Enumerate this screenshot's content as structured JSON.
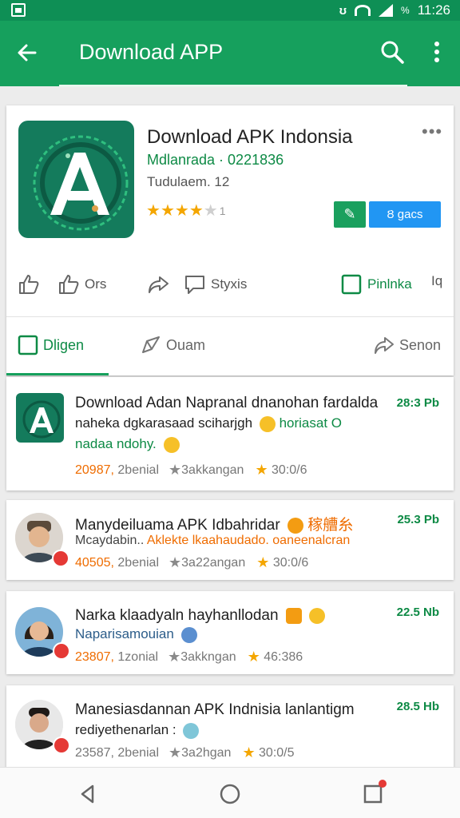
{
  "status_bar": {
    "time": "11:26",
    "battery_text": "%"
  },
  "app_bar": {
    "title": "Download APP"
  },
  "app": {
    "name": "Download APK Indonsia",
    "developer": "Mdlanrada · 0221836",
    "version": "Tudulaem. 12",
    "rating_stars": 4,
    "rating_count": "1",
    "install_label": "Ȣ gacs"
  },
  "actions": {
    "like_label": "",
    "thumbs_label": "Ors",
    "share_label": "",
    "comment_label": "Styxis",
    "save_label": "Pinlnka",
    "info_label": "Iq"
  },
  "tabs": [
    {
      "label": "Dligen",
      "active": true
    },
    {
      "label": "Ouam",
      "active": false
    },
    {
      "label": "Senon",
      "active": false
    }
  ],
  "feed": [
    {
      "title": "Download Adan Napranal dnanohan fardalda",
      "line2": "naheka dgkarasaad sciharjgh",
      "line2b": "horiasat O",
      "line3": "nadaa ndohy.",
      "time": "28:3 Pb",
      "count": "20987,",
      "count_label": "2benial",
      "metric": "3akkangan",
      "rating": "30:0/6"
    },
    {
      "title": "Manydeiluama APK Idbahridar",
      "title_suffix": "稼艚糸",
      "subtitle": "Mcaydabin..",
      "subtitle_orange": "Aklekte lkaahaudado. oaneenalcran",
      "time": "25.3 Pb",
      "count": "40505,",
      "count_label": "2benial",
      "metric": "3a22angan",
      "rating": "30:0/6"
    },
    {
      "title": "Narka klaadyaln hayhanllodan",
      "subtitle": "Naparisamouian",
      "time": "22.5 Nb",
      "count": "23807,",
      "count_label": "1zonial",
      "metric": "3akkngan",
      "rating": "46:386"
    },
    {
      "title": "Manesiasdannan APK Indnisia lanlantigm",
      "subtitle": "rediyethenarlan :",
      "time": "28.5 Hb",
      "count": "23587,",
      "count_label": "2benial",
      "metric": "3a2hgan",
      "rating": "30:0/5"
    }
  ]
}
